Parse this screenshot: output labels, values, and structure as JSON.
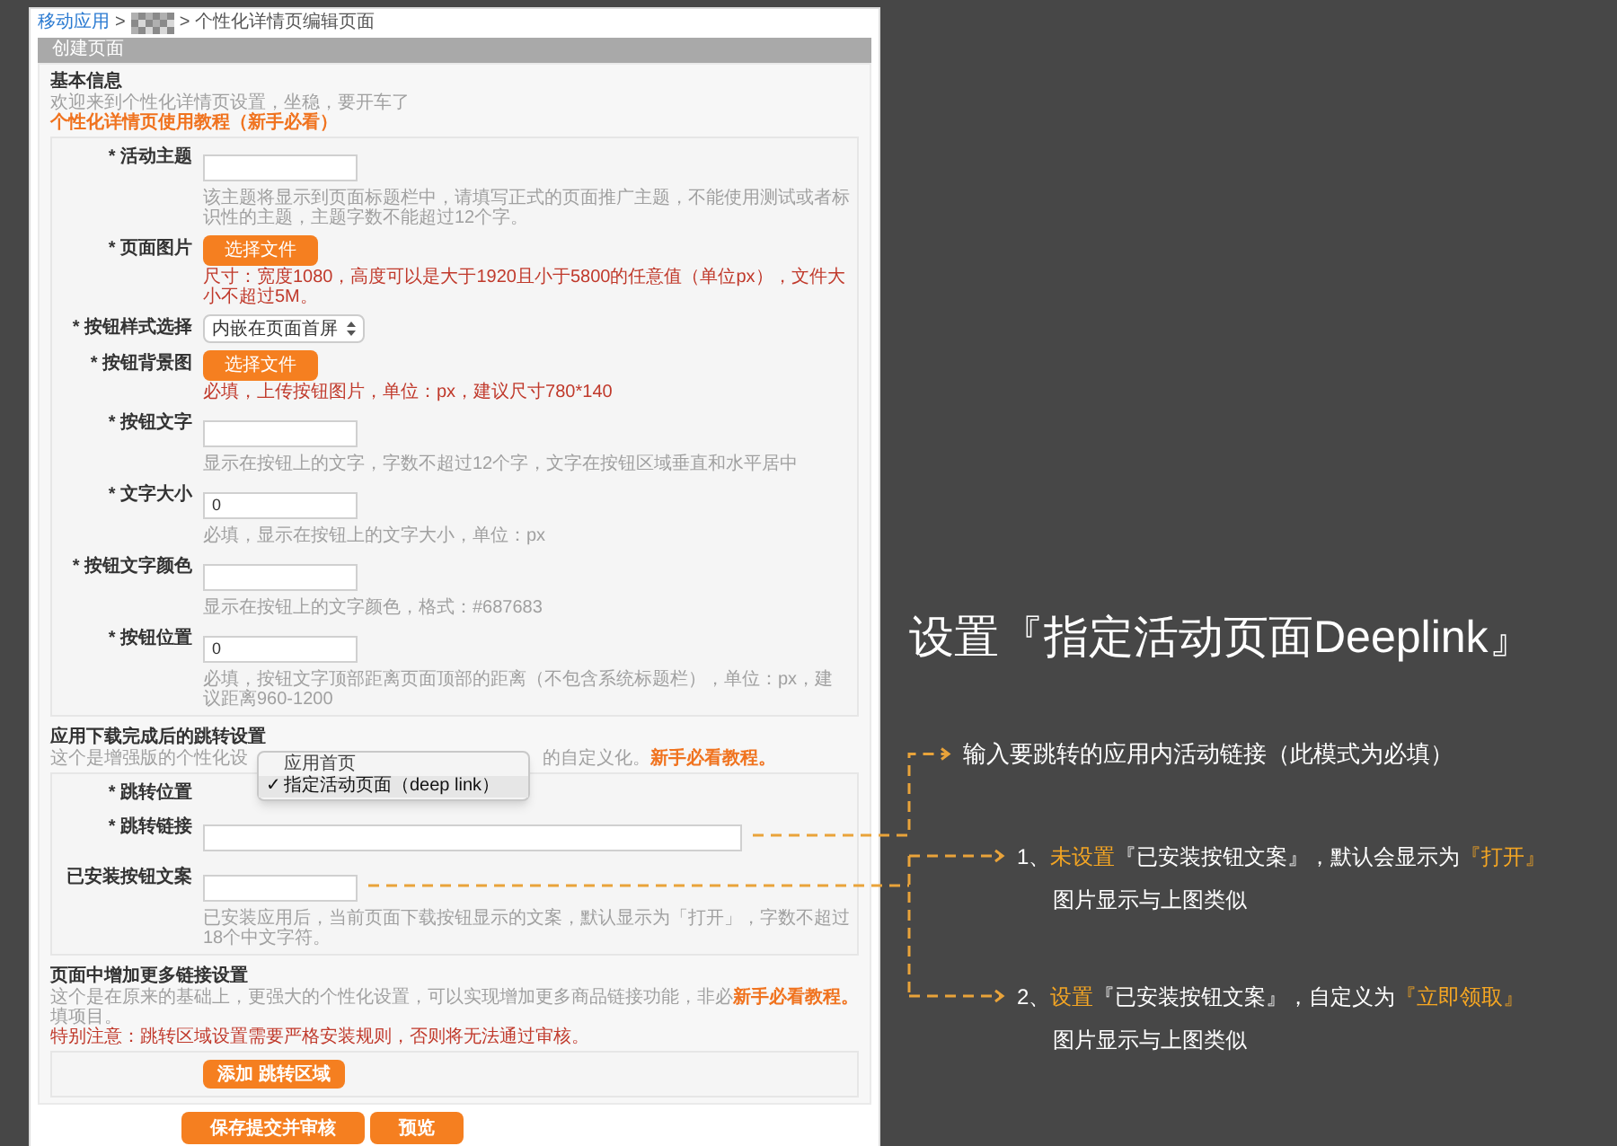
{
  "breadcrumb": [
    {
      "kind": "link",
      "text": "移动应用"
    },
    {
      "kind": "separator",
      "text": ">"
    },
    {
      "kind": "mosaic"
    },
    {
      "kind": "separator",
      "text": ">"
    },
    {
      "kind": "current",
      "text": "个性化详情页编辑页面"
    }
  ],
  "panel_title": "创建页面",
  "sections": [
    {
      "title": "基本信息",
      "intro": [
        [
          {
            "kind": "muted",
            "text": "欢迎来到个性化详情页设置，坐稳，要开车了"
          }
        ],
        [
          {
            "kind": "link",
            "text": "个性化详情页使用教程（新手必看）"
          }
        ]
      ],
      "fields": [
        {
          "kind": "text",
          "label": "* 活动主题",
          "hint": "该主题将显示到页面标题栏中，请填写正式的页面推广主题，不能使用测试或者标识性的主题，主题字数不能超过12个字。",
          "warning": false
        },
        {
          "kind": "file",
          "label": "* 页面图片",
          "button": "选择文件",
          "hint": "尺寸：宽度1080，高度可以是大于1920且小于5800的任意值（单位px），文件大小不超过5M。",
          "warning": true
        },
        {
          "kind": "select",
          "label": "* 按钮样式选择",
          "value": "内嵌在页面首屏"
        },
        {
          "kind": "file",
          "label": "* 按钮背景图",
          "button": "选择文件",
          "hint": "必填，上传按钮图片，单位：px，建议尺寸780*140",
          "warning": true
        },
        {
          "kind": "text",
          "label": "* 按钮文字",
          "hint": "显示在按钮上的文字，字数不超过12个字，文字在按钮区域垂直和水平居中",
          "warning": false
        },
        {
          "kind": "text",
          "label": "* 文字大小",
          "value": "0",
          "hint": "必填，显示在按钮上的文字大小，单位：px",
          "warning": false
        },
        {
          "kind": "text",
          "label": "* 按钮文字颜色",
          "hint": "显示在按钮上的文字颜色，格式：#687683",
          "warning": false
        },
        {
          "kind": "text",
          "label": "* 按钮位置",
          "value": "0",
          "hint": "必填，按钮文字顶部距离页面顶部的距离（不包含系统标题栏），单位：px，建议距离960-1200",
          "warning": false
        }
      ]
    },
    {
      "title": "应用下载完成后的跳转设置",
      "intro": [
        [
          {
            "kind": "muted",
            "text": "这个是增强版的个性化设"
          },
          {
            "kind": "gap"
          },
          {
            "kind": "muted",
            "text": "的自定义化。"
          },
          {
            "kind": "link",
            "text": "新手必看教程。"
          }
        ]
      ],
      "fields": [
        {
          "kind": "menu",
          "label": "* 跳转位置",
          "options": [
            {
              "label": "应用首页",
              "selected": false
            },
            {
              "label": "指定活动页面（deep link）",
              "selected": true
            }
          ],
          "check": "✓"
        },
        {
          "kind": "text",
          "label": "* 跳转链接",
          "wide": true
        },
        {
          "kind": "text",
          "label": "已安装按钮文案",
          "hint": "已安装应用后，当前页面下载按钮显示的文案，默认显示为「打开」，字数不超过18个中文字符。",
          "warning": false
        }
      ]
    },
    {
      "title": "页面中增加更多链接设置",
      "intro": [
        [
          {
            "kind": "muted",
            "text": "这个是在原来的基础上，更强大的个性化设置，可以实现增加更多商品链接功能，非必填项目。"
          },
          {
            "kind": "link",
            "text": "新手必看教程。"
          }
        ],
        [
          {
            "kind": "warning",
            "text": "特别注意：跳转区域设置需要严格安装规则，否则将无法通过审核。"
          }
        ]
      ],
      "fields": [
        {
          "kind": "add",
          "button": "添加 跳转区域"
        }
      ]
    }
  ],
  "actions": [
    {
      "label": "保存提交并审核"
    },
    {
      "label": "预览"
    }
  ],
  "annotations": {
    "title": "设置『指定活动页面Deeplink』",
    "link_note": "输入要跳转的应用内活动链接（此模式为必填）",
    "notes": [
      {
        "parts": [
          {
            "text": "1、",
            "highlight": false
          },
          {
            "text": "未设置",
            "highlight": true
          },
          {
            "text": "『已安装按钮文案』，默认会显示为",
            "highlight": false
          },
          {
            "text": "『打开』",
            "highlight": true
          }
        ],
        "sub": "图片显示与上图类似"
      },
      {
        "parts": [
          {
            "text": "2、",
            "highlight": false
          },
          {
            "text": "设置",
            "highlight": true
          },
          {
            "text": "『已安装按钮文案』，自定义为",
            "highlight": false
          },
          {
            "text": "『立即领取』",
            "highlight": true
          }
        ],
        "sub": "图片显示与上图类似"
      }
    ]
  }
}
